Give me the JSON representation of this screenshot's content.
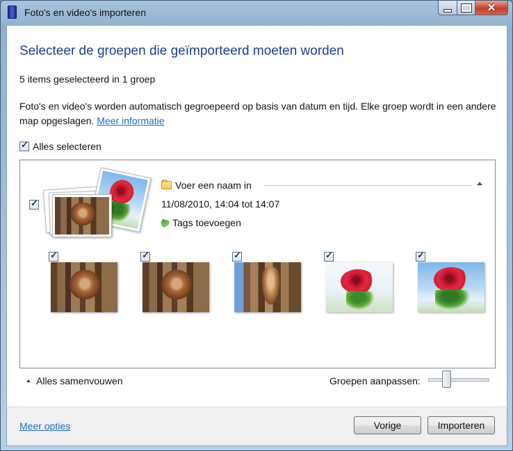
{
  "window": {
    "title": "Foto's en video's importeren"
  },
  "heading": "Selecteer de groepen die geïmporteerd moeten worden",
  "selection_info": "5 items geselecteerd in 1 groep",
  "description": "Foto's en video's worden automatisch gegroepeerd op basis van datum en tijd. Elke groep wordt in een andere map opgeslagen.",
  "more_info_link": "Meer informatie",
  "select_all_label": "Alles selecteren",
  "group": {
    "name_placeholder": "Voer een naam in",
    "date_range": "11/08/2010, 14:04 tot 14:07",
    "add_tags": "Tags toevoegen",
    "checked": true
  },
  "thumbnails": [
    {
      "subject": "dog",
      "checked": true
    },
    {
      "subject": "dog",
      "checked": true
    },
    {
      "subject": "dog-portrait",
      "checked": true
    },
    {
      "subject": "rose",
      "checked": true
    },
    {
      "subject": "rose-sky",
      "checked": true
    }
  ],
  "collapse_all": "Alles samenvouwen",
  "adjust_groups_label": "Groepen aanpassen:",
  "slider_level": 0.3,
  "footer": {
    "more_options": "Meer opties",
    "previous_button": "Vorige",
    "import_button": "Importeren"
  },
  "icons": [
    "app-icon",
    "minimize-icon",
    "maximize-icon",
    "close-icon",
    "checkbox-icon",
    "folder-icon",
    "tag-add-icon",
    "collapse-chevron-icon"
  ],
  "colors": {
    "heading": "#1d3f94",
    "link": "#1a6fc0",
    "close_button": "#c4412b"
  }
}
